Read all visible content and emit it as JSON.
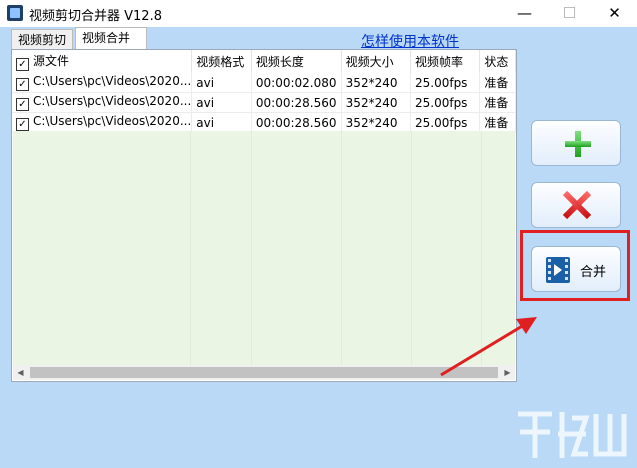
{
  "window": {
    "title": "视频剪切合并器 V12.8",
    "minimize": "—",
    "maximize": "☐",
    "close": "✕"
  },
  "tabs": [
    {
      "label": "视频剪切"
    },
    {
      "label": "视频合并"
    }
  ],
  "help_link": "怎样使用本软件",
  "table": {
    "columns": [
      "源文件",
      "视频格式",
      "视频长度",
      "视频大小",
      "视频帧率",
      "状态"
    ],
    "rows": [
      {
        "checked": true,
        "file": "C:\\Users\\pc\\Videos\\2020...",
        "format": "avi",
        "duration": "00:00:02.080",
        "size": "352*240",
        "fps": "25.00fps",
        "status": "准备"
      },
      {
        "checked": true,
        "file": "C:\\Users\\pc\\Videos\\2020...",
        "format": "avi",
        "duration": "00:00:28.560",
        "size": "352*240",
        "fps": "25.00fps",
        "status": "准备"
      },
      {
        "checked": true,
        "file": "C:\\Users\\pc\\Videos\\2020...",
        "format": "avi",
        "duration": "00:00:28.560",
        "size": "352*240",
        "fps": "25.00fps",
        "status": "准备"
      }
    ]
  },
  "buttons": {
    "merge_label": "合并"
  },
  "colors": {
    "background": "#b9d9f7",
    "highlight": "#e02020",
    "add": "#22aa22",
    "delete": "#d01818"
  }
}
